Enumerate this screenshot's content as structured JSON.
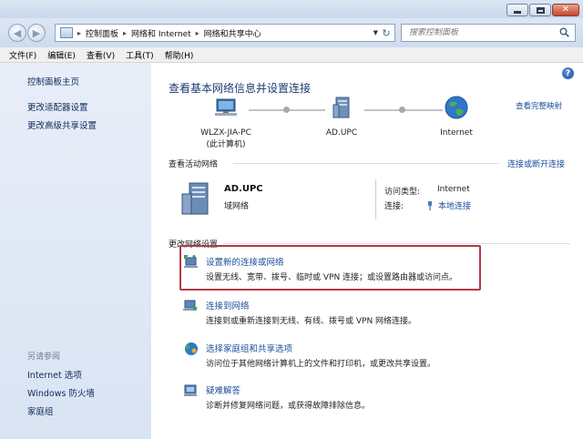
{
  "window": {
    "close_glyph": "✕"
  },
  "nav": {
    "back_glyph": "◀",
    "forward_glyph": "▶",
    "breadcrumb": [
      "控制面板",
      "网络和 Internet",
      "网络和共享中心"
    ],
    "breadcrumb_sep": "▸",
    "dropdown_glyph": "▼",
    "refresh_glyph": "↻",
    "search_placeholder": "搜索控制面板"
  },
  "menu": [
    "文件(F)",
    "编辑(E)",
    "查看(V)",
    "工具(T)",
    "帮助(H)"
  ],
  "left_pane": {
    "home": "控制面板主页",
    "adapter": "更改适配器设置",
    "sharing": "更改高级共享设置",
    "see_also": "另请参阅",
    "internet_options": "Internet 选项",
    "firewall": "Windows 防火墙",
    "homegroup": "家庭组"
  },
  "main": {
    "help_glyph": "?",
    "heading": "查看基本网络信息并设置连接",
    "view_full_map": "查看完整映射",
    "nodes": {
      "pc_name": "WLZX-JIA-PC",
      "pc_sub": "(此计算机)",
      "network": "AD.UPC",
      "internet": "Internet"
    },
    "active_section": "查看活动网络",
    "connect_disconnect": "连接或断开连接",
    "active_network": {
      "name": "AD.UPC",
      "type": "域网络",
      "access_type_label": "访问类型:",
      "access_type_value": "Internet",
      "connections_label": "连接:",
      "connections_value": "本地连接"
    },
    "change_section": "更改网络设置",
    "tasks": {
      "new_title": "设置新的连接或网络",
      "new_desc": "设置无线、宽带、拨号、临时或 VPN 连接；或设置路由器或访问点。",
      "connect_title": "连接到网络",
      "connect_desc": "连接到或重新连接到无线、有线、拨号或 VPN 网络连接。",
      "homegroup_title": "选择家庭组和共享选项",
      "homegroup_desc": "访问位于其他网络计算机上的文件和打印机，或更改共享设置。",
      "troubleshoot_title": "疑难解答",
      "troubleshoot_desc": "诊断并修复网络问题，或获得故障排除信息。"
    }
  },
  "colors": {
    "link": "#1a4f9c",
    "highlight": "#b33a45",
    "left_pane_bg": "#e3eaf6"
  },
  "icons": [
    "minimize-icon",
    "maximize-icon",
    "close-icon",
    "back-arrow-icon",
    "forward-arrow-icon",
    "control-panel-icon",
    "refresh-icon",
    "search-icon",
    "help-icon",
    "computer-icon",
    "domain-network-icon",
    "globe-icon",
    "network-connection-icon",
    "new-connection-icon",
    "connect-network-icon",
    "homegroup-icon",
    "troubleshoot-icon"
  ]
}
